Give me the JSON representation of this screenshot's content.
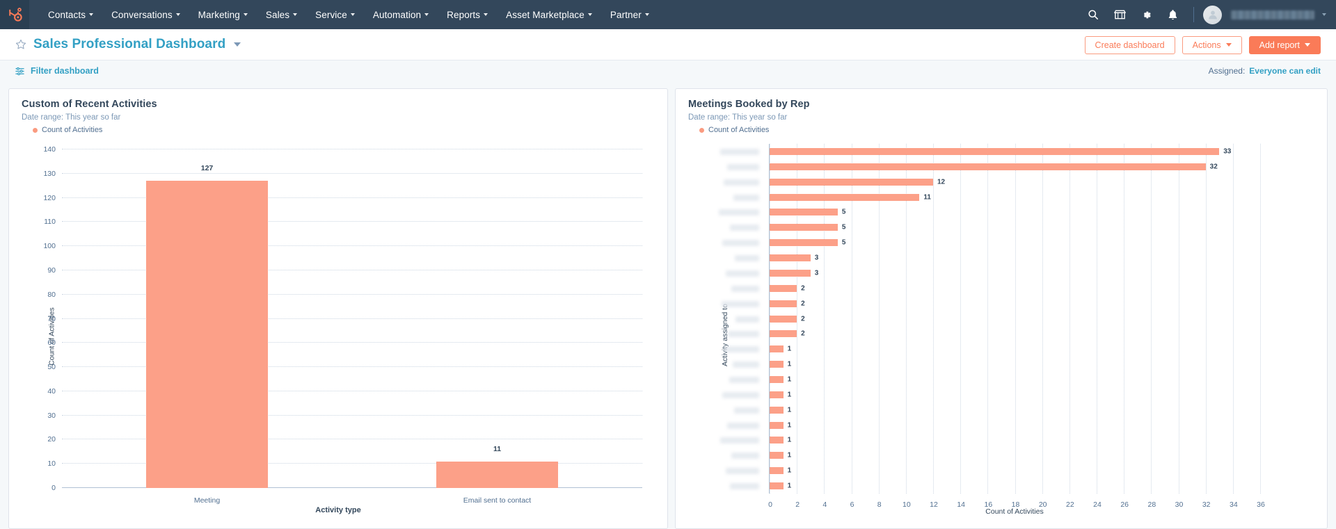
{
  "nav": {
    "logo": "hubspot-sprocket-logo",
    "items": [
      {
        "label": "Contacts",
        "has_caret": true
      },
      {
        "label": "Conversations",
        "has_caret": true
      },
      {
        "label": "Marketing",
        "has_caret": true
      },
      {
        "label": "Sales",
        "has_caret": true
      },
      {
        "label": "Service",
        "has_caret": true
      },
      {
        "label": "Automation",
        "has_caret": true
      },
      {
        "label": "Reports",
        "has_caret": true
      },
      {
        "label": "Asset Marketplace",
        "has_caret": true
      },
      {
        "label": "Partner",
        "has_caret": true
      }
    ],
    "icons": [
      "search-icon",
      "marketplace-icon",
      "settings-gear-icon",
      "notifications-bell-icon"
    ],
    "account_name": "",
    "background_color": "#33475b"
  },
  "titlebar": {
    "title": "Sales Professional Dashboard",
    "star_icon": "star-outline-icon",
    "title_caret": "chevron-down-icon",
    "buttons": {
      "create_dashboard": "Create dashboard",
      "actions": "Actions",
      "add_report": "Add report"
    }
  },
  "filterbar": {
    "filter_icon": "filter-sliders-icon",
    "filter_label": "Filter dashboard",
    "assigned_label": "Assigned:",
    "assigned_value": "Everyone can edit"
  },
  "theme": {
    "bar_color": "#fca088",
    "accent_orange": "#fa7b58",
    "link_blue": "#33a0c4",
    "nav_navy": "#33475b",
    "canvas": "#f5f8fa"
  },
  "chart_data": [
    {
      "type": "bar",
      "orientation": "vertical",
      "title": "Custom of Recent Activities",
      "subtitle": "Date range: This year so far",
      "legend": [
        "Count of Activities"
      ],
      "legend_position": "top-left",
      "series_color": "#fca088",
      "categories": [
        "Meeting",
        "Email sent to contact"
      ],
      "values": [
        127,
        11
      ],
      "xlabel": "Activity type",
      "ylabel": "Count of Activities",
      "ylim": [
        0,
        140
      ],
      "yticks": [
        0,
        10,
        20,
        30,
        40,
        50,
        60,
        70,
        80,
        90,
        100,
        110,
        120,
        130,
        140
      ],
      "grid": true,
      "data_labels": true
    },
    {
      "type": "bar",
      "orientation": "horizontal",
      "title": "Meetings Booked by Rep",
      "subtitle": "Date range: This year so far",
      "legend": [
        "Count of Activities"
      ],
      "legend_position": "top-left",
      "series_color": "#fca088",
      "categories": [
        "",
        "",
        "",
        "",
        "",
        "",
        "",
        "",
        "",
        "",
        "",
        "",
        "",
        "",
        "",
        "",
        "",
        "",
        "",
        "",
        "",
        "",
        ""
      ],
      "categories_redacted": true,
      "values": [
        33,
        32,
        12,
        11,
        5,
        5,
        5,
        3,
        3,
        2,
        2,
        2,
        2,
        1,
        1,
        1,
        1,
        1,
        1,
        1,
        1,
        1,
        1
      ],
      "xlabel": "Count of Activities",
      "ylabel": "Activity assigned to",
      "xlim": [
        0,
        36
      ],
      "xticks": [
        0,
        2,
        4,
        6,
        8,
        10,
        12,
        14,
        16,
        18,
        20,
        22,
        24,
        26,
        28,
        30,
        32,
        34,
        36
      ],
      "grid": true,
      "data_labels": true
    }
  ]
}
